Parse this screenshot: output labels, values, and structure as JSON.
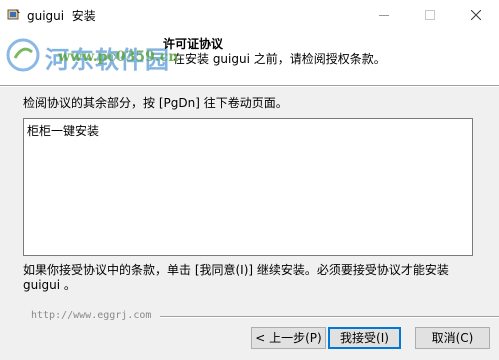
{
  "window": {
    "app_name": "guigui",
    "title_suffix": "安装",
    "icon": "installer-icon"
  },
  "header": {
    "title": "许可证协议",
    "subtitle": "在安装 guigui 之前，请检阅授权条款。"
  },
  "watermark": {
    "site_name": "河东软件园",
    "url": "www.pc0359.cn"
  },
  "body": {
    "instruction": "检阅协议的其余部分，按 [PgDn] 往下卷动页面。",
    "license_text": "柜柜一键安装",
    "accept_text": "如果你接受协议中的条款，单击 [我同意(I)] 继续安装。必须要接受协议才能安装 guigui 。"
  },
  "footer": {
    "branding": "http://www.eggrj.com",
    "back_label": "< 上一步(P)",
    "agree_label": "我接受(I)",
    "cancel_label": "取消(C)"
  }
}
